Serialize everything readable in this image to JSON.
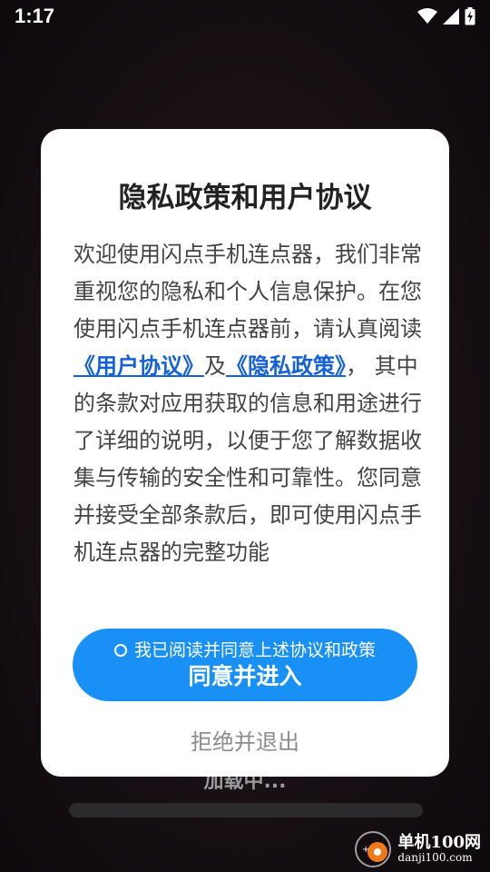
{
  "status_bar": {
    "time": "1:17",
    "icons": [
      "wifi-icon",
      "signal-icon",
      "battery-charging-icon"
    ]
  },
  "background": {
    "loading_text": "加载中..."
  },
  "dialog": {
    "title": "隐私政策和用户协议",
    "body": {
      "intro": "欢迎使用闪点手机连点器，我们非常重视您的隐私和个人信息保护。在您使用闪点手机连点器前，请认真阅读",
      "user_agreement_link": "《用户协议》",
      "and": "及",
      "privacy_policy_link": "《隐私政策》",
      "rest": "， 其中的条款对应用获取的信息和用途进行了详细的说明，以便于您了解数据收集与传输的安全性和可靠性。您同意并接受全部条款后，即可使用闪点手机连点器的完整功能"
    },
    "agree_button": {
      "checkbox_label": "我已阅读并同意上述协议和政策",
      "main_label": "同意并进入"
    },
    "decline_label": "拒绝并退出"
  },
  "watermark": {
    "name": "单机100网",
    "url": "danji100.com"
  },
  "colors": {
    "accent": "#1890f5",
    "link": "#1561d6",
    "dialog_bg": "#ffffff"
  }
}
